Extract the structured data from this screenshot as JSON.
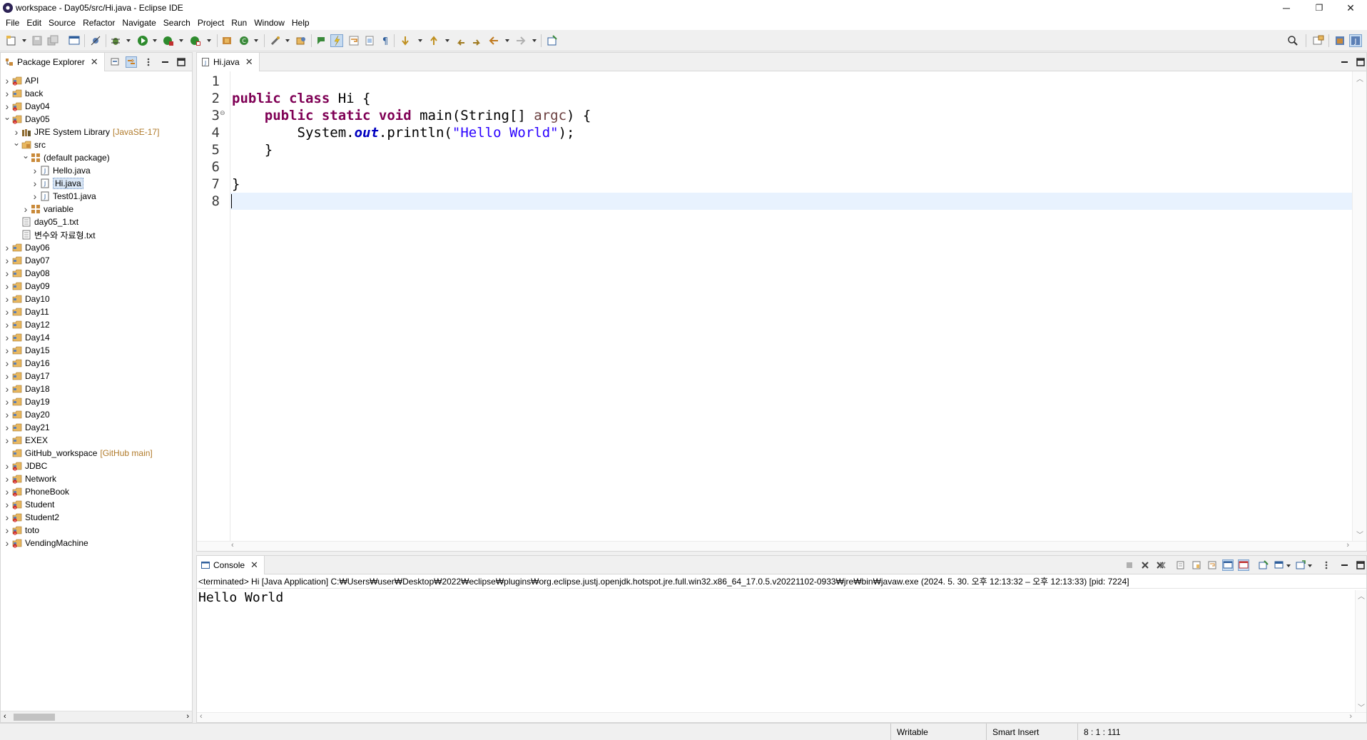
{
  "window": {
    "title": "workspace - Day05/src/Hi.java - Eclipse IDE",
    "controls": {
      "minimize": "─",
      "restore": "❐",
      "close": "✕"
    }
  },
  "menu": [
    "File",
    "Edit",
    "Source",
    "Refactor",
    "Navigate",
    "Search",
    "Project",
    "Run",
    "Window",
    "Help"
  ],
  "package_explorer": {
    "tab_label": "Package Explorer",
    "items": [
      {
        "label": "API",
        "kind": "project-error",
        "level": 0,
        "expand": "collapsed"
      },
      {
        "label": "back",
        "kind": "project",
        "level": 0,
        "expand": "collapsed"
      },
      {
        "label": "Day04",
        "kind": "project-error",
        "level": 0,
        "expand": "collapsed"
      },
      {
        "label": "Day05",
        "kind": "project-error",
        "level": 0,
        "expand": "expanded"
      },
      {
        "label": "JRE System Library",
        "deco": "[JavaSE-17]",
        "kind": "library",
        "level": 1,
        "expand": "collapsed"
      },
      {
        "label": "src",
        "kind": "src-folder",
        "level": 1,
        "expand": "expanded"
      },
      {
        "label": "(default package)",
        "kind": "package",
        "level": 2,
        "expand": "expanded"
      },
      {
        "label": "Hello.java",
        "kind": "java-file",
        "level": 3,
        "expand": "collapsed"
      },
      {
        "label": "Hi.java",
        "kind": "java-file",
        "level": 3,
        "expand": "collapsed",
        "selected": true
      },
      {
        "label": "Test01.java",
        "kind": "java-file",
        "level": 3,
        "expand": "collapsed"
      },
      {
        "label": "variable",
        "kind": "package",
        "level": 2,
        "expand": "collapsed"
      },
      {
        "label": "day05_1.txt",
        "kind": "text-file",
        "level": 1,
        "expand": "none"
      },
      {
        "label": "변수와 자료형.txt",
        "kind": "text-file",
        "level": 1,
        "expand": "none"
      },
      {
        "label": "Day06",
        "kind": "project",
        "level": 0,
        "expand": "collapsed"
      },
      {
        "label": "Day07",
        "kind": "project",
        "level": 0,
        "expand": "collapsed"
      },
      {
        "label": "Day08",
        "kind": "project",
        "level": 0,
        "expand": "collapsed"
      },
      {
        "label": "Day09",
        "kind": "project",
        "level": 0,
        "expand": "collapsed"
      },
      {
        "label": "Day10",
        "kind": "project",
        "level": 0,
        "expand": "collapsed"
      },
      {
        "label": "Day11",
        "kind": "project",
        "level": 0,
        "expand": "collapsed"
      },
      {
        "label": "Day12",
        "kind": "project",
        "level": 0,
        "expand": "collapsed"
      },
      {
        "label": "Day14",
        "kind": "project",
        "level": 0,
        "expand": "collapsed"
      },
      {
        "label": "Day15",
        "kind": "project",
        "level": 0,
        "expand": "collapsed"
      },
      {
        "label": "Day16",
        "kind": "project",
        "level": 0,
        "expand": "collapsed"
      },
      {
        "label": "Day17",
        "kind": "project",
        "level": 0,
        "expand": "collapsed"
      },
      {
        "label": "Day18",
        "kind": "project",
        "level": 0,
        "expand": "collapsed"
      },
      {
        "label": "Day19",
        "kind": "project",
        "level": 0,
        "expand": "collapsed"
      },
      {
        "label": "Day20",
        "kind": "project",
        "level": 0,
        "expand": "collapsed"
      },
      {
        "label": "Day21",
        "kind": "project",
        "level": 0,
        "expand": "collapsed"
      },
      {
        "label": "EXEX",
        "kind": "project",
        "level": 0,
        "expand": "collapsed"
      },
      {
        "label": "GitHub_workspace",
        "deco": "[GitHub main]",
        "kind": "project",
        "level": 0,
        "expand": "none"
      },
      {
        "label": "JDBC",
        "kind": "project-error",
        "level": 0,
        "expand": "collapsed"
      },
      {
        "label": "Network",
        "kind": "project-error",
        "level": 0,
        "expand": "collapsed"
      },
      {
        "label": "PhoneBook",
        "kind": "project-error",
        "level": 0,
        "expand": "collapsed"
      },
      {
        "label": "Student",
        "kind": "project-error",
        "level": 0,
        "expand": "collapsed"
      },
      {
        "label": "Student2",
        "kind": "project-error",
        "level": 0,
        "expand": "collapsed"
      },
      {
        "label": "toto",
        "kind": "project-error",
        "level": 0,
        "expand": "collapsed"
      },
      {
        "label": "VendingMachine",
        "kind": "project-error",
        "level": 0,
        "expand": "collapsed"
      }
    ]
  },
  "editor": {
    "tab_label": "Hi.java",
    "lines": [
      {
        "n": "1",
        "tokens": []
      },
      {
        "n": "2",
        "tokens": [
          {
            "t": "public class",
            "c": "kw"
          },
          {
            "t": " Hi {",
            "c": ""
          }
        ]
      },
      {
        "n": "3",
        "fold": true,
        "tokens": [
          {
            "t": "    ",
            "c": ""
          },
          {
            "t": "public static void",
            "c": "kw"
          },
          {
            "t": " main(String[] ",
            "c": ""
          },
          {
            "t": "argc",
            "c": "param"
          },
          {
            "t": ") {",
            "c": ""
          }
        ]
      },
      {
        "n": "4",
        "tokens": [
          {
            "t": "        System.",
            "c": ""
          },
          {
            "t": "out",
            "c": "fld"
          },
          {
            "t": ".println(",
            "c": ""
          },
          {
            "t": "\"Hello World\"",
            "c": "str"
          },
          {
            "t": ");",
            "c": ""
          }
        ]
      },
      {
        "n": "5",
        "tokens": [
          {
            "t": "    }",
            "c": ""
          }
        ]
      },
      {
        "n": "6",
        "tokens": []
      },
      {
        "n": "7",
        "tokens": [
          {
            "t": "}",
            "c": ""
          }
        ]
      },
      {
        "n": "8",
        "tokens": [],
        "current": true
      }
    ]
  },
  "console": {
    "tab_label": "Console",
    "header": "<terminated> Hi [Java Application] C:₩Users₩user₩Desktop₩2022₩eclipse₩plugins₩org.eclipse.justj.openjdk.hotspot.jre.full.win32.x86_64_17.0.5.v20221102-0933₩jre₩bin₩javaw.exe  (2024. 5. 30. 오후 12:13:32 – 오후 12:13:33) [pid: 7224]",
    "output": "Hello World"
  },
  "statusbar": {
    "writable": "Writable",
    "insert_mode": "Smart Insert",
    "position": "8 : 1 : 111"
  },
  "colors": {
    "keyword": "#7f0055",
    "string": "#2a00ff",
    "field": "#0000c0",
    "current_line": "#e8f2fe",
    "selection": "#d9e6f5"
  }
}
